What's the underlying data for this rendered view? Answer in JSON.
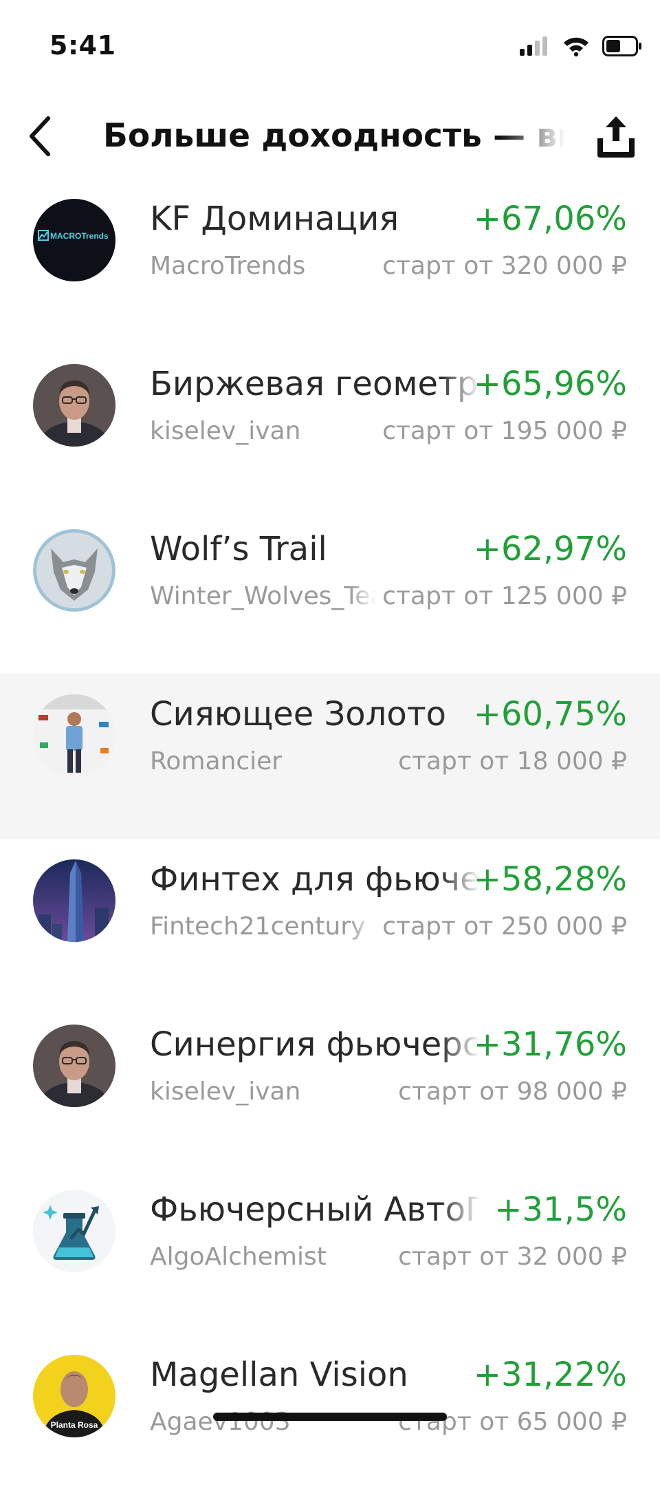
{
  "status_bar": {
    "time": "5:41",
    "icons": [
      "cellular-signal-icon",
      "wifi-icon",
      "battery-icon"
    ]
  },
  "nav": {
    "back_icon": "chevron-left-icon",
    "title": "Больше доходность — выше риск",
    "share_icon": "share-upload-icon"
  },
  "colors": {
    "yield_positive": "#21a038",
    "secondary_text": "#9a9a9a",
    "highlight_row": "#f5f5f5"
  },
  "strategies": [
    {
      "name": "KF Доминация",
      "author": "MacroTrends",
      "yield": "+67,06%",
      "start": "старт от 320 000 ₽",
      "avatar": "macrotrends-logo",
      "avatar_text": "MACROTrends"
    },
    {
      "name": "Биржевая геометрия",
      "author": "kiselev_ivan",
      "yield": "+65,96%",
      "start": "старт от 195 000 ₽",
      "avatar": "person-glasses-photo"
    },
    {
      "name": "Wolf’s Trail",
      "author": "Winter_Wolves_Team",
      "yield": "+62,97%",
      "start": "старт от 125 000 ₽",
      "avatar": "wolf-portrait"
    },
    {
      "name": "Сияющее Золото",
      "author": "Romancier",
      "yield": "+60,75%",
      "start": "старт от 18 000 ₽",
      "avatar": "person-standing-photo"
    },
    {
      "name": "Финтех для фьючерсов",
      "author": "Fintech21century",
      "yield": "+58,28%",
      "start": "старт от 250 000 ₽",
      "avatar": "skyscraper-photo"
    },
    {
      "name": "Синергия фьючерсов",
      "author": "kiselev_ivan",
      "yield": "+31,76%",
      "start": "старт от 98 000 ₽",
      "avatar": "person-glasses-photo"
    },
    {
      "name": "Фьючерсный АвтоПилот",
      "author": "AlgoAlchemist",
      "yield": "+31,5%",
      "start": "старт от 32 000 ₽",
      "avatar": "flask-chart-logo"
    },
    {
      "name": "Magellan Vision",
      "author": "Agaev1003",
      "yield": "+31,22%",
      "start": "старт от 65 000 ₽",
      "avatar": "person-yellow-photo",
      "avatar_text": "Planta Rosa"
    }
  ]
}
